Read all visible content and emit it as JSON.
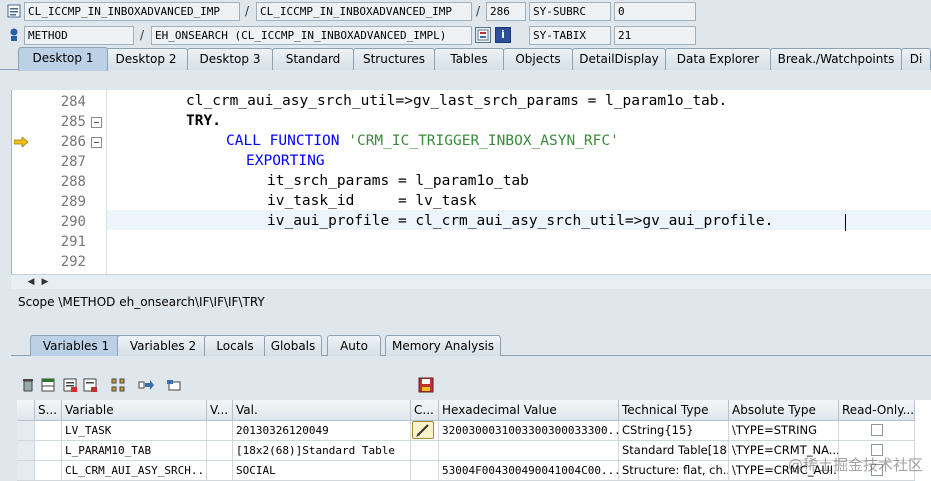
{
  "header": {
    "row1": {
      "class_field": "CL_ICCMP_IN_INBOXADVANCED_IMP",
      "class_field2": "CL_ICCMP_IN_INBOXADVANCED_IMP",
      "line": "286",
      "var_name": "SY-SUBRC",
      "var_value": "0"
    },
    "row2": {
      "type_field": "METHOD",
      "method_field": "EH_ONSEARCH (CL_ICCMP_IN_INBOXADVANCED_IMPL)",
      "var_name": "SY-TABIX",
      "var_value": "21"
    }
  },
  "top_tabs": [
    "Desktop 1",
    "Desktop 2",
    "Desktop 3",
    "Standard",
    "Structures",
    "Tables",
    "Objects",
    "DetailDisplay",
    "Data Explorer",
    "Break./Watchpoints",
    "Di"
  ],
  "editor": {
    "lines": [
      {
        "no": "284",
        "code": "cl_crm_aui_asy_srch_util=>gv_last_srch_params = l_param1o_tab."
      },
      {
        "no": "285",
        "code": "TRY."
      },
      {
        "no": "286",
        "code_kw": "CALL FUNCTION",
        "code_str": "'CRM_IC_TRIGGER_INBOX_ASYN_RFC'"
      },
      {
        "no": "287",
        "code": "EXPORTING"
      },
      {
        "no": "288",
        "code": "it_srch_params = l_param1o_tab"
      },
      {
        "no": "289",
        "code": "iv_task_id     = lv_task"
      },
      {
        "no": "290",
        "code": "iv_aui_profile = cl_crm_aui_asy_srch_util=>gv_aui_profile."
      },
      {
        "no": "291",
        "code": ""
      },
      {
        "no": "292",
        "code": ""
      }
    ]
  },
  "scope": "Scope \\METHOD eh_onsearch\\IF\\IF\\IF\\TRY",
  "lower_tabs": [
    "Variables 1",
    "Variables 2",
    "Locals",
    "Globals",
    "Auto",
    "Memory Analysis"
  ],
  "grid": {
    "headers": [
      "S...",
      "Variable",
      "V...",
      "Val.",
      "C...",
      "Hexadecimal Value",
      "Technical Type",
      "Absolute Type",
      "Read-Only..."
    ],
    "rows": [
      {
        "variable": "LV_TASK",
        "value": "20130326120049",
        "hex": "3200300031003300300033300...",
        "tech": "CString{15}",
        "abs": "\\TYPE=STRING"
      },
      {
        "variable": "L_PARAM10_TAB",
        "value": "[18x2(68)]Standard Table",
        "hex": "",
        "tech": "Standard Table[18...",
        "abs": "\\TYPE=CRMT_NA..."
      },
      {
        "variable": "CL_CRM_AUI_ASY_SRCH...",
        "value": "SOCIAL",
        "hex": "53004F004300490041004C00...",
        "tech": "Structure: flat, ch...",
        "abs": "\\TYPE=CRMC_AUI..."
      }
    ]
  },
  "watermark": "@稀土掘金技术社区",
  "colors": {
    "accent": "#0000ff",
    "string": "#3c8a3c",
    "tab_active": "#bcd1e6"
  }
}
